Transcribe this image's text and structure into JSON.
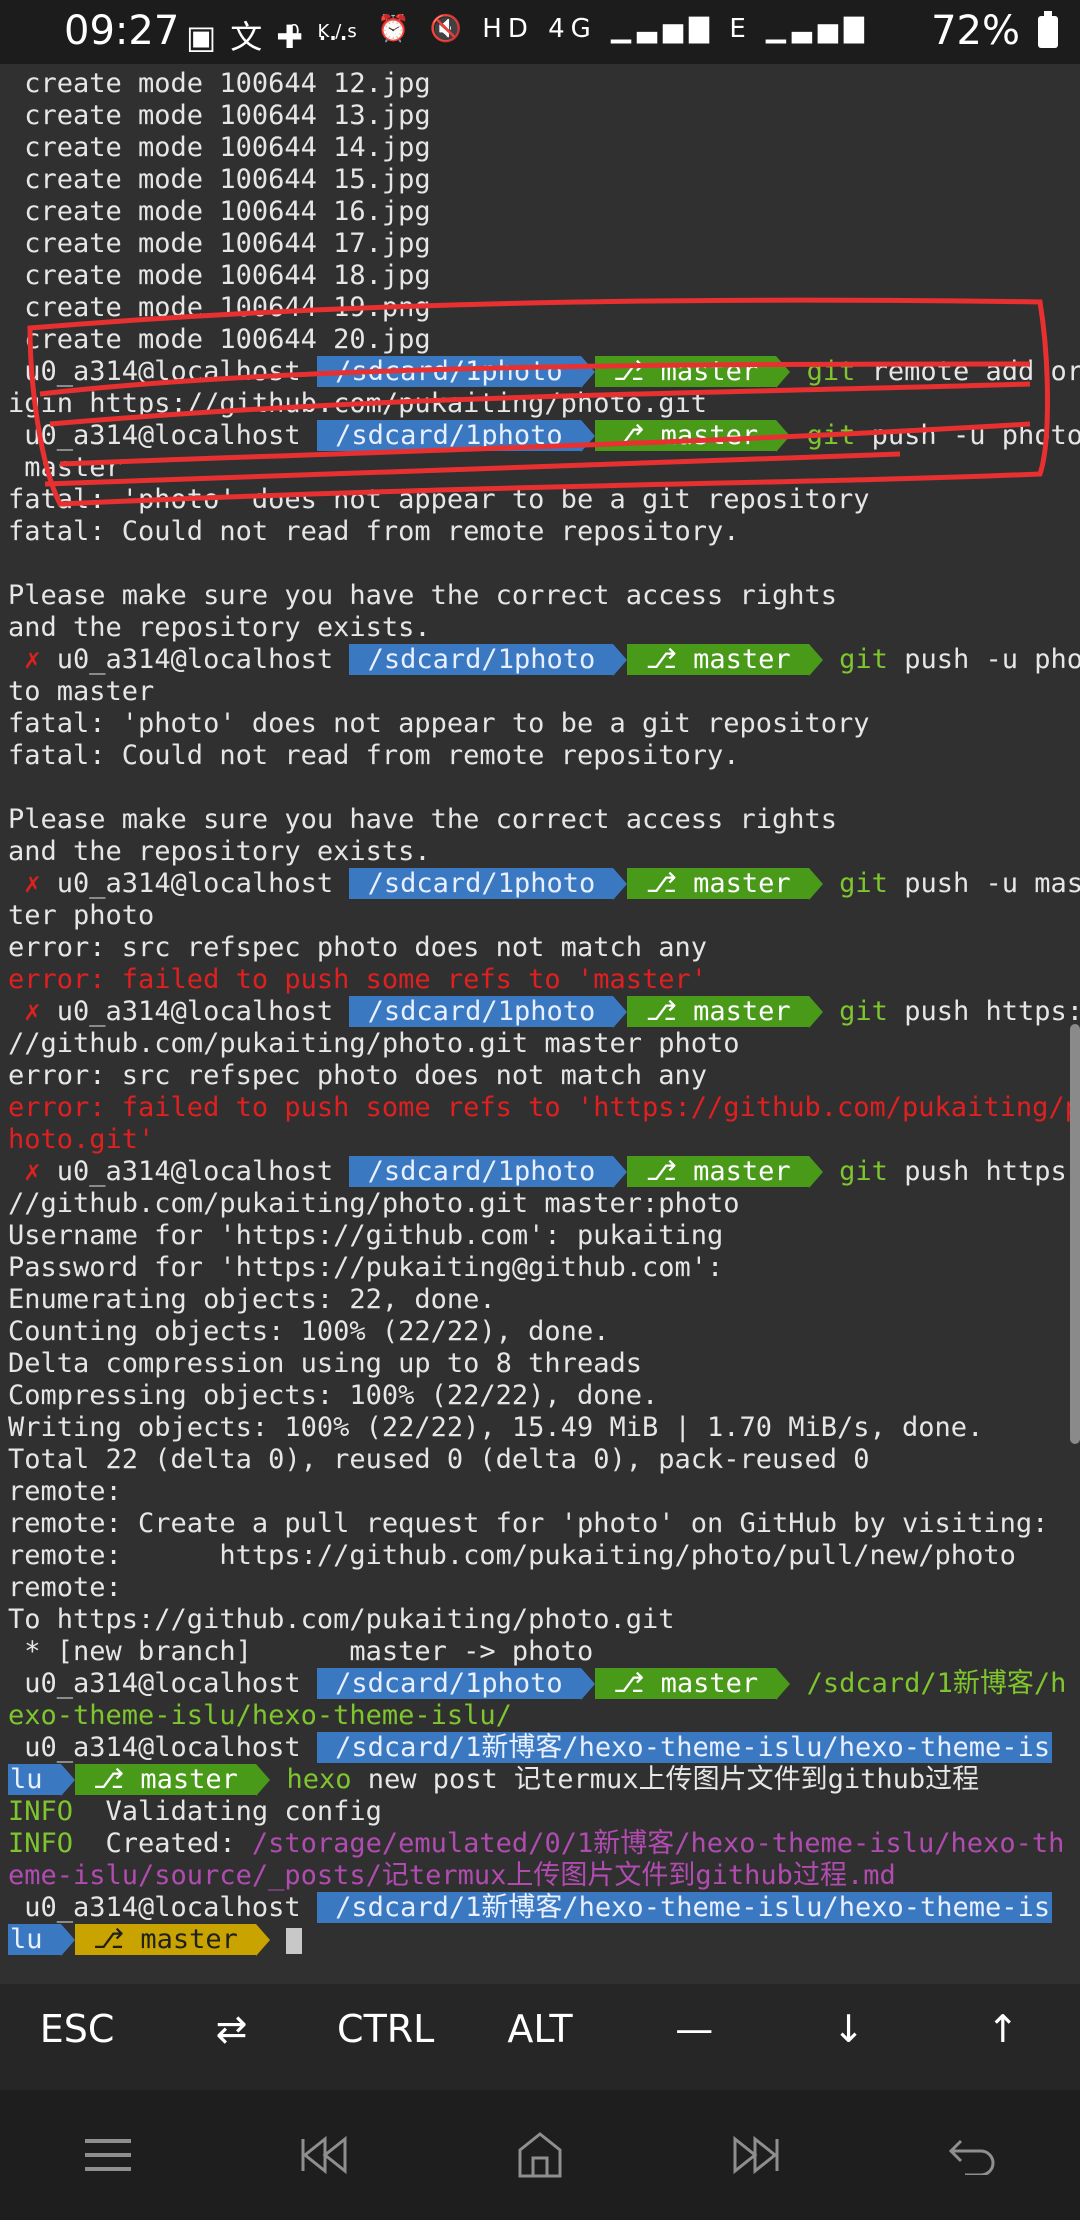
{
  "status_bar": {
    "time": "09:27",
    "left_icons": [
      "image-icon",
      "translate-icon",
      "puzzle-icon",
      "more-icon"
    ],
    "net_speed": "0 K/s",
    "right_icons_text": "⏰ 🔇 HD 4G ▁▃▅▇ E ▁▃▅▇",
    "battery": "72%"
  },
  "terminal": {
    "lines": [
      {
        "segments": [
          {
            "t": " create mode 100644 12.jpg"
          }
        ]
      },
      {
        "segments": [
          {
            "t": " create mode 100644 13.jpg"
          }
        ]
      },
      {
        "segments": [
          {
            "t": " create mode 100644 14.jpg"
          }
        ]
      },
      {
        "segments": [
          {
            "t": " create mode 100644 15.jpg"
          }
        ]
      },
      {
        "segments": [
          {
            "t": " create mode 100644 16.jpg"
          }
        ]
      },
      {
        "segments": [
          {
            "t": " create mode 100644 17.jpg"
          }
        ]
      },
      {
        "segments": [
          {
            "t": " create mode 100644 18.jpg"
          }
        ]
      },
      {
        "segments": [
          {
            "t": " create mode 100644 19.png"
          }
        ]
      },
      {
        "segments": [
          {
            "t": " create mode 100644 20.jpg"
          }
        ]
      },
      {
        "segments": [
          {
            "t": " u0_a314@localhost "
          },
          {
            "t": " /sdcard/1photo ",
            "c": "seg-path"
          },
          {
            "arrow": "a-blue"
          },
          {
            "t": " ⎇ master ",
            "c": "seg-branch"
          },
          {
            "arrow": "a-green"
          },
          {
            "t": " git",
            "c": "green"
          },
          {
            "t": " remote add or"
          }
        ]
      },
      {
        "segments": [
          {
            "t": "igin https://github.com/pukaiting/photo.git"
          }
        ]
      },
      {
        "segments": [
          {
            "t": " u0_a314@localhost "
          },
          {
            "t": " /sdcard/1photo ",
            "c": "seg-path"
          },
          {
            "arrow": "a-blue"
          },
          {
            "t": " ⎇ master ",
            "c": "seg-branch"
          },
          {
            "arrow": "a-green"
          },
          {
            "t": " git",
            "c": "green"
          },
          {
            "t": " push -u photo"
          }
        ]
      },
      {
        "segments": [
          {
            "t": " master"
          }
        ]
      },
      {
        "segments": [
          {
            "t": "fatal: 'photo' does not appear to be a git repository"
          }
        ]
      },
      {
        "segments": [
          {
            "t": "fatal: Could not read from remote repository."
          }
        ]
      },
      {
        "segments": [
          {
            "t": ""
          }
        ]
      },
      {
        "segments": [
          {
            "t": "Please make sure you have the correct access rights"
          }
        ]
      },
      {
        "segments": [
          {
            "t": "and the repository exists."
          }
        ]
      },
      {
        "segments": [
          {
            "t": " ✗ ",
            "c": "red"
          },
          {
            "t": "u0_a314@localhost "
          },
          {
            "t": " /sdcard/1photo ",
            "c": "seg-path"
          },
          {
            "arrow": "a-blue"
          },
          {
            "t": " ⎇ master ",
            "c": "seg-branch"
          },
          {
            "arrow": "a-green"
          },
          {
            "t": " git",
            "c": "green"
          },
          {
            "t": " push -u pho"
          }
        ]
      },
      {
        "segments": [
          {
            "t": "to master"
          }
        ]
      },
      {
        "segments": [
          {
            "t": "fatal: 'photo' does not appear to be a git repository"
          }
        ]
      },
      {
        "segments": [
          {
            "t": "fatal: Could not read from remote repository."
          }
        ]
      },
      {
        "segments": [
          {
            "t": ""
          }
        ]
      },
      {
        "segments": [
          {
            "t": "Please make sure you have the correct access rights"
          }
        ]
      },
      {
        "segments": [
          {
            "t": "and the repository exists."
          }
        ]
      },
      {
        "segments": [
          {
            "t": " ✗ ",
            "c": "red"
          },
          {
            "t": "u0_a314@localhost "
          },
          {
            "t": " /sdcard/1photo ",
            "c": "seg-path"
          },
          {
            "arrow": "a-blue"
          },
          {
            "t": " ⎇ master ",
            "c": "seg-branch"
          },
          {
            "arrow": "a-green"
          },
          {
            "t": " git",
            "c": "green"
          },
          {
            "t": " push -u mas"
          }
        ]
      },
      {
        "segments": [
          {
            "t": "ter photo"
          }
        ]
      },
      {
        "segments": [
          {
            "t": "error: src refspec photo does not match any"
          }
        ]
      },
      {
        "segments": [
          {
            "t": "error: failed to push some refs to 'master'",
            "c": "red"
          }
        ]
      },
      {
        "segments": [
          {
            "t": " ✗ ",
            "c": "red"
          },
          {
            "t": "u0_a314@localhost "
          },
          {
            "t": " /sdcard/1photo ",
            "c": "seg-path"
          },
          {
            "arrow": "a-blue"
          },
          {
            "t": " ⎇ master ",
            "c": "seg-branch"
          },
          {
            "arrow": "a-green"
          },
          {
            "t": " git",
            "c": "green"
          },
          {
            "t": " push https:"
          }
        ]
      },
      {
        "segments": [
          {
            "t": "//github.com/pukaiting/photo.git master photo"
          }
        ]
      },
      {
        "segments": [
          {
            "t": "error: src refspec photo does not match any"
          }
        ]
      },
      {
        "segments": [
          {
            "t": "error: failed to push some refs to 'https://github.com/pukaiting/p",
            "c": "red"
          }
        ]
      },
      {
        "segments": [
          {
            "t": "hoto.git'",
            "c": "red"
          }
        ]
      },
      {
        "segments": [
          {
            "t": " ✗ ",
            "c": "red"
          },
          {
            "t": "u0_a314@localhost "
          },
          {
            "t": " /sdcard/1photo ",
            "c": "seg-path"
          },
          {
            "arrow": "a-blue"
          },
          {
            "t": " ⎇ master ",
            "c": "seg-branch"
          },
          {
            "arrow": "a-green"
          },
          {
            "t": " git",
            "c": "green"
          },
          {
            "t": " push https:"
          }
        ]
      },
      {
        "segments": [
          {
            "t": "//github.com/pukaiting/photo.git master:photo"
          }
        ]
      },
      {
        "segments": [
          {
            "t": "Username for 'https://github.com': pukaiting"
          }
        ]
      },
      {
        "segments": [
          {
            "t": "Password for 'https://pukaiting@github.com':"
          }
        ]
      },
      {
        "segments": [
          {
            "t": "Enumerating objects: 22, done."
          }
        ]
      },
      {
        "segments": [
          {
            "t": "Counting objects: 100% (22/22), done."
          }
        ]
      },
      {
        "segments": [
          {
            "t": "Delta compression using up to 8 threads"
          }
        ]
      },
      {
        "segments": [
          {
            "t": "Compressing objects: 100% (22/22), done."
          }
        ]
      },
      {
        "segments": [
          {
            "t": "Writing objects: 100% (22/22), 15.49 MiB | 1.70 MiB/s, done."
          }
        ]
      },
      {
        "segments": [
          {
            "t": "Total 22 (delta 0), reused 0 (delta 0), pack-reused 0"
          }
        ]
      },
      {
        "segments": [
          {
            "t": "remote:"
          }
        ]
      },
      {
        "segments": [
          {
            "t": "remote: Create a pull request for 'photo' on GitHub by visiting:"
          }
        ]
      },
      {
        "segments": [
          {
            "t": "remote:      https://github.com/pukaiting/photo/pull/new/photo"
          }
        ]
      },
      {
        "segments": [
          {
            "t": "remote:"
          }
        ]
      },
      {
        "segments": [
          {
            "t": "To https://github.com/pukaiting/photo.git"
          }
        ]
      },
      {
        "segments": [
          {
            "t": " * [new branch]      master -> photo"
          }
        ]
      },
      {
        "segments": [
          {
            "t": " u0_a314@localhost "
          },
          {
            "t": " /sdcard/1photo ",
            "c": "seg-path"
          },
          {
            "arrow": "a-blue"
          },
          {
            "t": " ⎇ master ",
            "c": "seg-branch"
          },
          {
            "arrow": "a-green"
          },
          {
            "t": " /sdcard/1新博客/h",
            "c": "green"
          }
        ]
      },
      {
        "segments": [
          {
            "t": "exo-theme-islu/hexo-theme-islu/",
            "c": "green"
          }
        ]
      },
      {
        "segments": [
          {
            "t": " u0_a314@localhost "
          },
          {
            "t": " /sdcard/1新博客/hexo-theme-islu/hexo-theme-is",
            "c": "seg-path"
          }
        ]
      },
      {
        "segments": [
          {
            "t": "lu ",
            "c": "seg-path"
          },
          {
            "arrow": "a-blue"
          },
          {
            "t": " ⎇ master ",
            "c": "seg-branch"
          },
          {
            "arrow": "a-green"
          },
          {
            "t": " hexo",
            "c": "green"
          },
          {
            "t": " new post 记termux上传图片文件到github过程"
          }
        ]
      },
      {
        "segments": [
          {
            "t": "INFO",
            "c": "green"
          },
          {
            "t": "  Validating config"
          }
        ]
      },
      {
        "segments": [
          {
            "t": "INFO",
            "c": "green"
          },
          {
            "t": "  Created: "
          },
          {
            "t": "/storage/emulated/0/1新博客/hexo-theme-islu/hexo-th",
            "c": "mag"
          }
        ]
      },
      {
        "segments": [
          {
            "t": "eme-islu/source/_posts/记termux上传图片文件到github过程.md",
            "c": "mag"
          }
        ]
      },
      {
        "segments": [
          {
            "t": " u0_a314@localhost "
          },
          {
            "t": " /sdcard/1新博客/hexo-theme-islu/hexo-theme-is",
            "c": "seg-path"
          }
        ]
      },
      {
        "segments": [
          {
            "t": "lu ",
            "c": "seg-path"
          },
          {
            "arrow": "a-blue"
          },
          {
            "t": " ⎇ master ",
            "c": "seg-branch-y"
          },
          {
            "arrow": "a-yellow"
          },
          {
            "t": " "
          },
          {
            "cursor": true
          }
        ]
      }
    ]
  },
  "extra_keys": [
    "ESC",
    "⇄",
    "CTRL",
    "ALT",
    "—",
    "↓",
    "↑"
  ],
  "nav_bar": [
    "menu-icon",
    "previous-icon",
    "home-icon",
    "next-icon",
    "back-icon"
  ]
}
